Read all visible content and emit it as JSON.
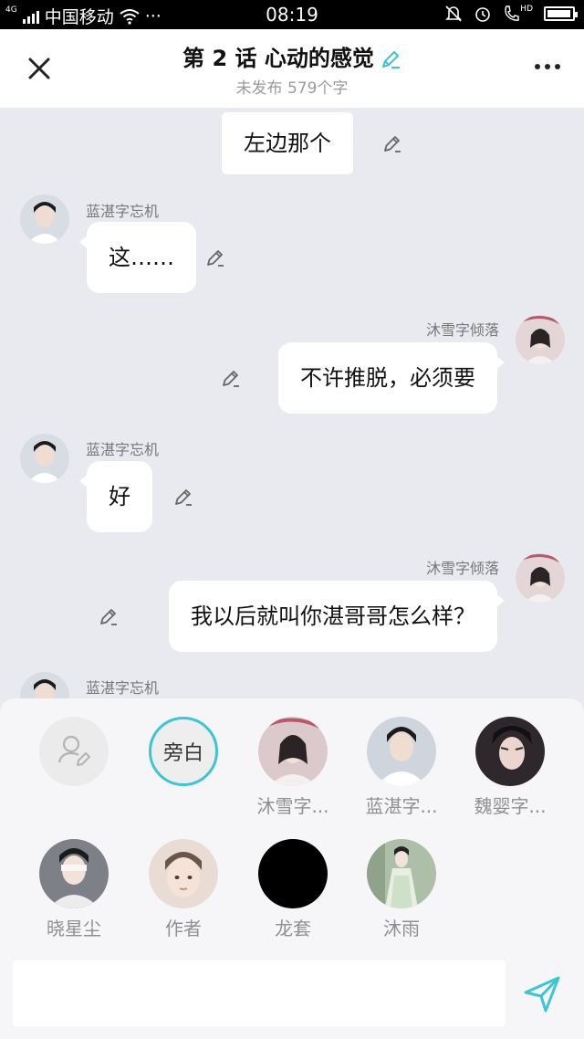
{
  "status_bar": {
    "network": "4G",
    "carrier": "中国移动",
    "dots": "···",
    "time": "08:19",
    "hd": "HD",
    "battery_level": 0.95
  },
  "header": {
    "title": "第 2 话 心动的感觉",
    "subtitle": "未发布 579个字"
  },
  "messages": [
    {
      "side": "center",
      "text": "左边那个"
    },
    {
      "side": "left",
      "name": "蓝湛字忘机",
      "text": "这……"
    },
    {
      "side": "right",
      "name": "沐雪字倾落",
      "text": "不许推脱，必须要"
    },
    {
      "side": "left",
      "name": "蓝湛字忘机",
      "text": "好"
    },
    {
      "side": "right",
      "name": "沐雪字倾落",
      "text": "我以后就叫你湛哥哥怎么样？"
    },
    {
      "side": "left",
      "name": "蓝湛字忘机",
      "text": ""
    }
  ],
  "roles": [
    {
      "label": "",
      "kind": "add-role"
    },
    {
      "label": "旁白",
      "kind": "narrator",
      "inner": "旁白"
    },
    {
      "label": "沐雪字...",
      "kind": "avatar",
      "color": "#d9c6c8"
    },
    {
      "label": "蓝湛字...",
      "kind": "avatar",
      "color": "#cfd5dc"
    },
    {
      "label": "魏婴字...",
      "kind": "avatar",
      "color": "#3a3036"
    },
    {
      "label": "晓星尘",
      "kind": "avatar",
      "color": "#8d8f95"
    },
    {
      "label": "作者",
      "kind": "avatar",
      "color": "#e7d8cf"
    },
    {
      "label": "龙套",
      "kind": "avatar",
      "color": "#000000"
    },
    {
      "label": "沐雨",
      "kind": "avatar",
      "color": "#b8c6b4"
    }
  ],
  "input": {
    "value": "",
    "placeholder": ""
  },
  "colors": {
    "accent": "#3bc6d4",
    "background": "#e9eaef",
    "bubble": "#ffffff"
  }
}
